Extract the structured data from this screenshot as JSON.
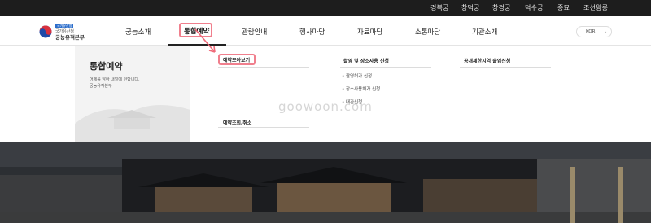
{
  "top_links": [
    "경복궁",
    "창덕궁",
    "창경궁",
    "덕수궁",
    "종묘",
    "조선왕릉"
  ],
  "logo": {
    "badge": "국가유산청",
    "line1": "국가유산청",
    "line2": "궁능유적본부"
  },
  "nav": {
    "items": [
      "궁능소개",
      "통합예약",
      "관람안내",
      "행사마당",
      "자료마당",
      "소통마당",
      "기관소개"
    ],
    "active": "통합예약"
  },
  "language": {
    "selected": "KOR"
  },
  "mega_menu": {
    "panel_title": "통합예약",
    "panel_desc_line1": "어제를 담아 내일에 전합니다.",
    "panel_desc_line2": "궁능유적본부",
    "col1": {
      "title": "예약모아보기",
      "title2": "예약조회/취소"
    },
    "col2": {
      "title": "촬영 및 장소사용 신청",
      "items": [
        "촬영허가 신청",
        "장소사용허가 신청",
        "대관신청"
      ]
    },
    "col3": {
      "title": "공개제한지역 출입신청"
    }
  },
  "watermark": "goowoon.com",
  "colors": {
    "highlight": "#f07f8d",
    "topbar": "#1d1d1d"
  }
}
